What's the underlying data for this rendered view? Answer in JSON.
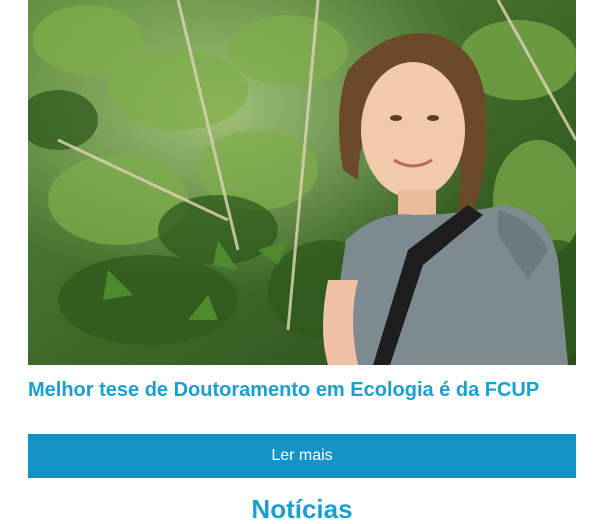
{
  "article": {
    "image_alt": "photo-researcher-in-forest",
    "title": "Melhor tese de Doutoramento em Ecologia é da FCUP",
    "read_more_label": "Ler mais"
  },
  "next_section": {
    "heading": "Notícias"
  },
  "colors": {
    "accent_text": "#1a9fd0",
    "button_bg": "#1592c6",
    "button_text": "#ffffff"
  }
}
